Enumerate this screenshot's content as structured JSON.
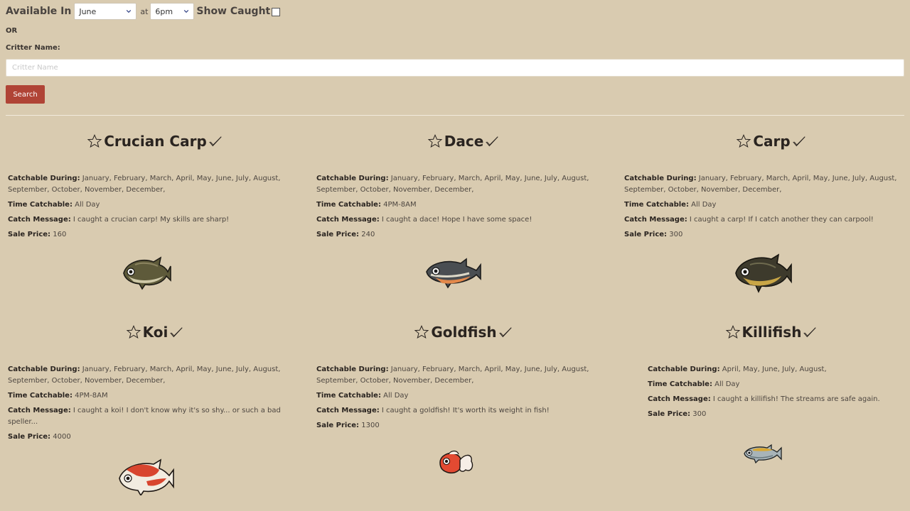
{
  "filters": {
    "available_label": "Available In",
    "month": "June",
    "at_label": "at",
    "time": "6pm",
    "show_caught_label": "Show Caught",
    "show_caught": false
  },
  "or_label": "OR",
  "critter": {
    "label": "Critter Name:",
    "placeholder": "Critter Name",
    "value": ""
  },
  "search_label": "Search",
  "labels": {
    "during": "Catchable During:",
    "time": "Time Catchable:",
    "message": "Catch Message:",
    "price": "Sale Price:"
  },
  "fish": [
    {
      "name": "Crucian Carp",
      "during": "January, February, March, April, May, June, July, August, September, October, November, December,",
      "time": "All Day",
      "message": "I caught a crucian carp! My skills are sharp!",
      "price": "160"
    },
    {
      "name": "Dace",
      "during": "January, February, March, April, May, June, July, August, September, October, November, December,",
      "time": "4PM-8AM",
      "message": "I caught a dace! Hope I have some space!",
      "price": "240"
    },
    {
      "name": "Carp",
      "during": "January, February, March, April, May, June, July, August, September, October, November, December,",
      "time": "All Day",
      "message": "I caught a carp! If I catch another they can carpool!",
      "price": "300"
    },
    {
      "name": "Koi",
      "during": "January, February, March, April, May, June, July, August, September, October, November, December,",
      "time": "4PM-8AM",
      "message": "I caught a koi! I don't know why it's so shy... or such a bad speller...",
      "price": "4000"
    },
    {
      "name": "Goldfish",
      "during": "January, February, March, April, May, June, July, August, September, October, November, December,",
      "time": "All Day",
      "message": "I caught a goldfish! It's worth its weight in fish!",
      "price": "1300"
    },
    {
      "name": "Killifish",
      "during": "April, May, June, July, August,",
      "time": "All Day",
      "message": "I caught a killifish! The streams are safe again.",
      "price": "300"
    }
  ],
  "icons": {
    "star": "star-outline-icon",
    "check": "checkmark-icon",
    "chevron": "chevron-down-icon"
  },
  "colors": {
    "background": "#d9cbb0",
    "search_button": "#b04436"
  }
}
